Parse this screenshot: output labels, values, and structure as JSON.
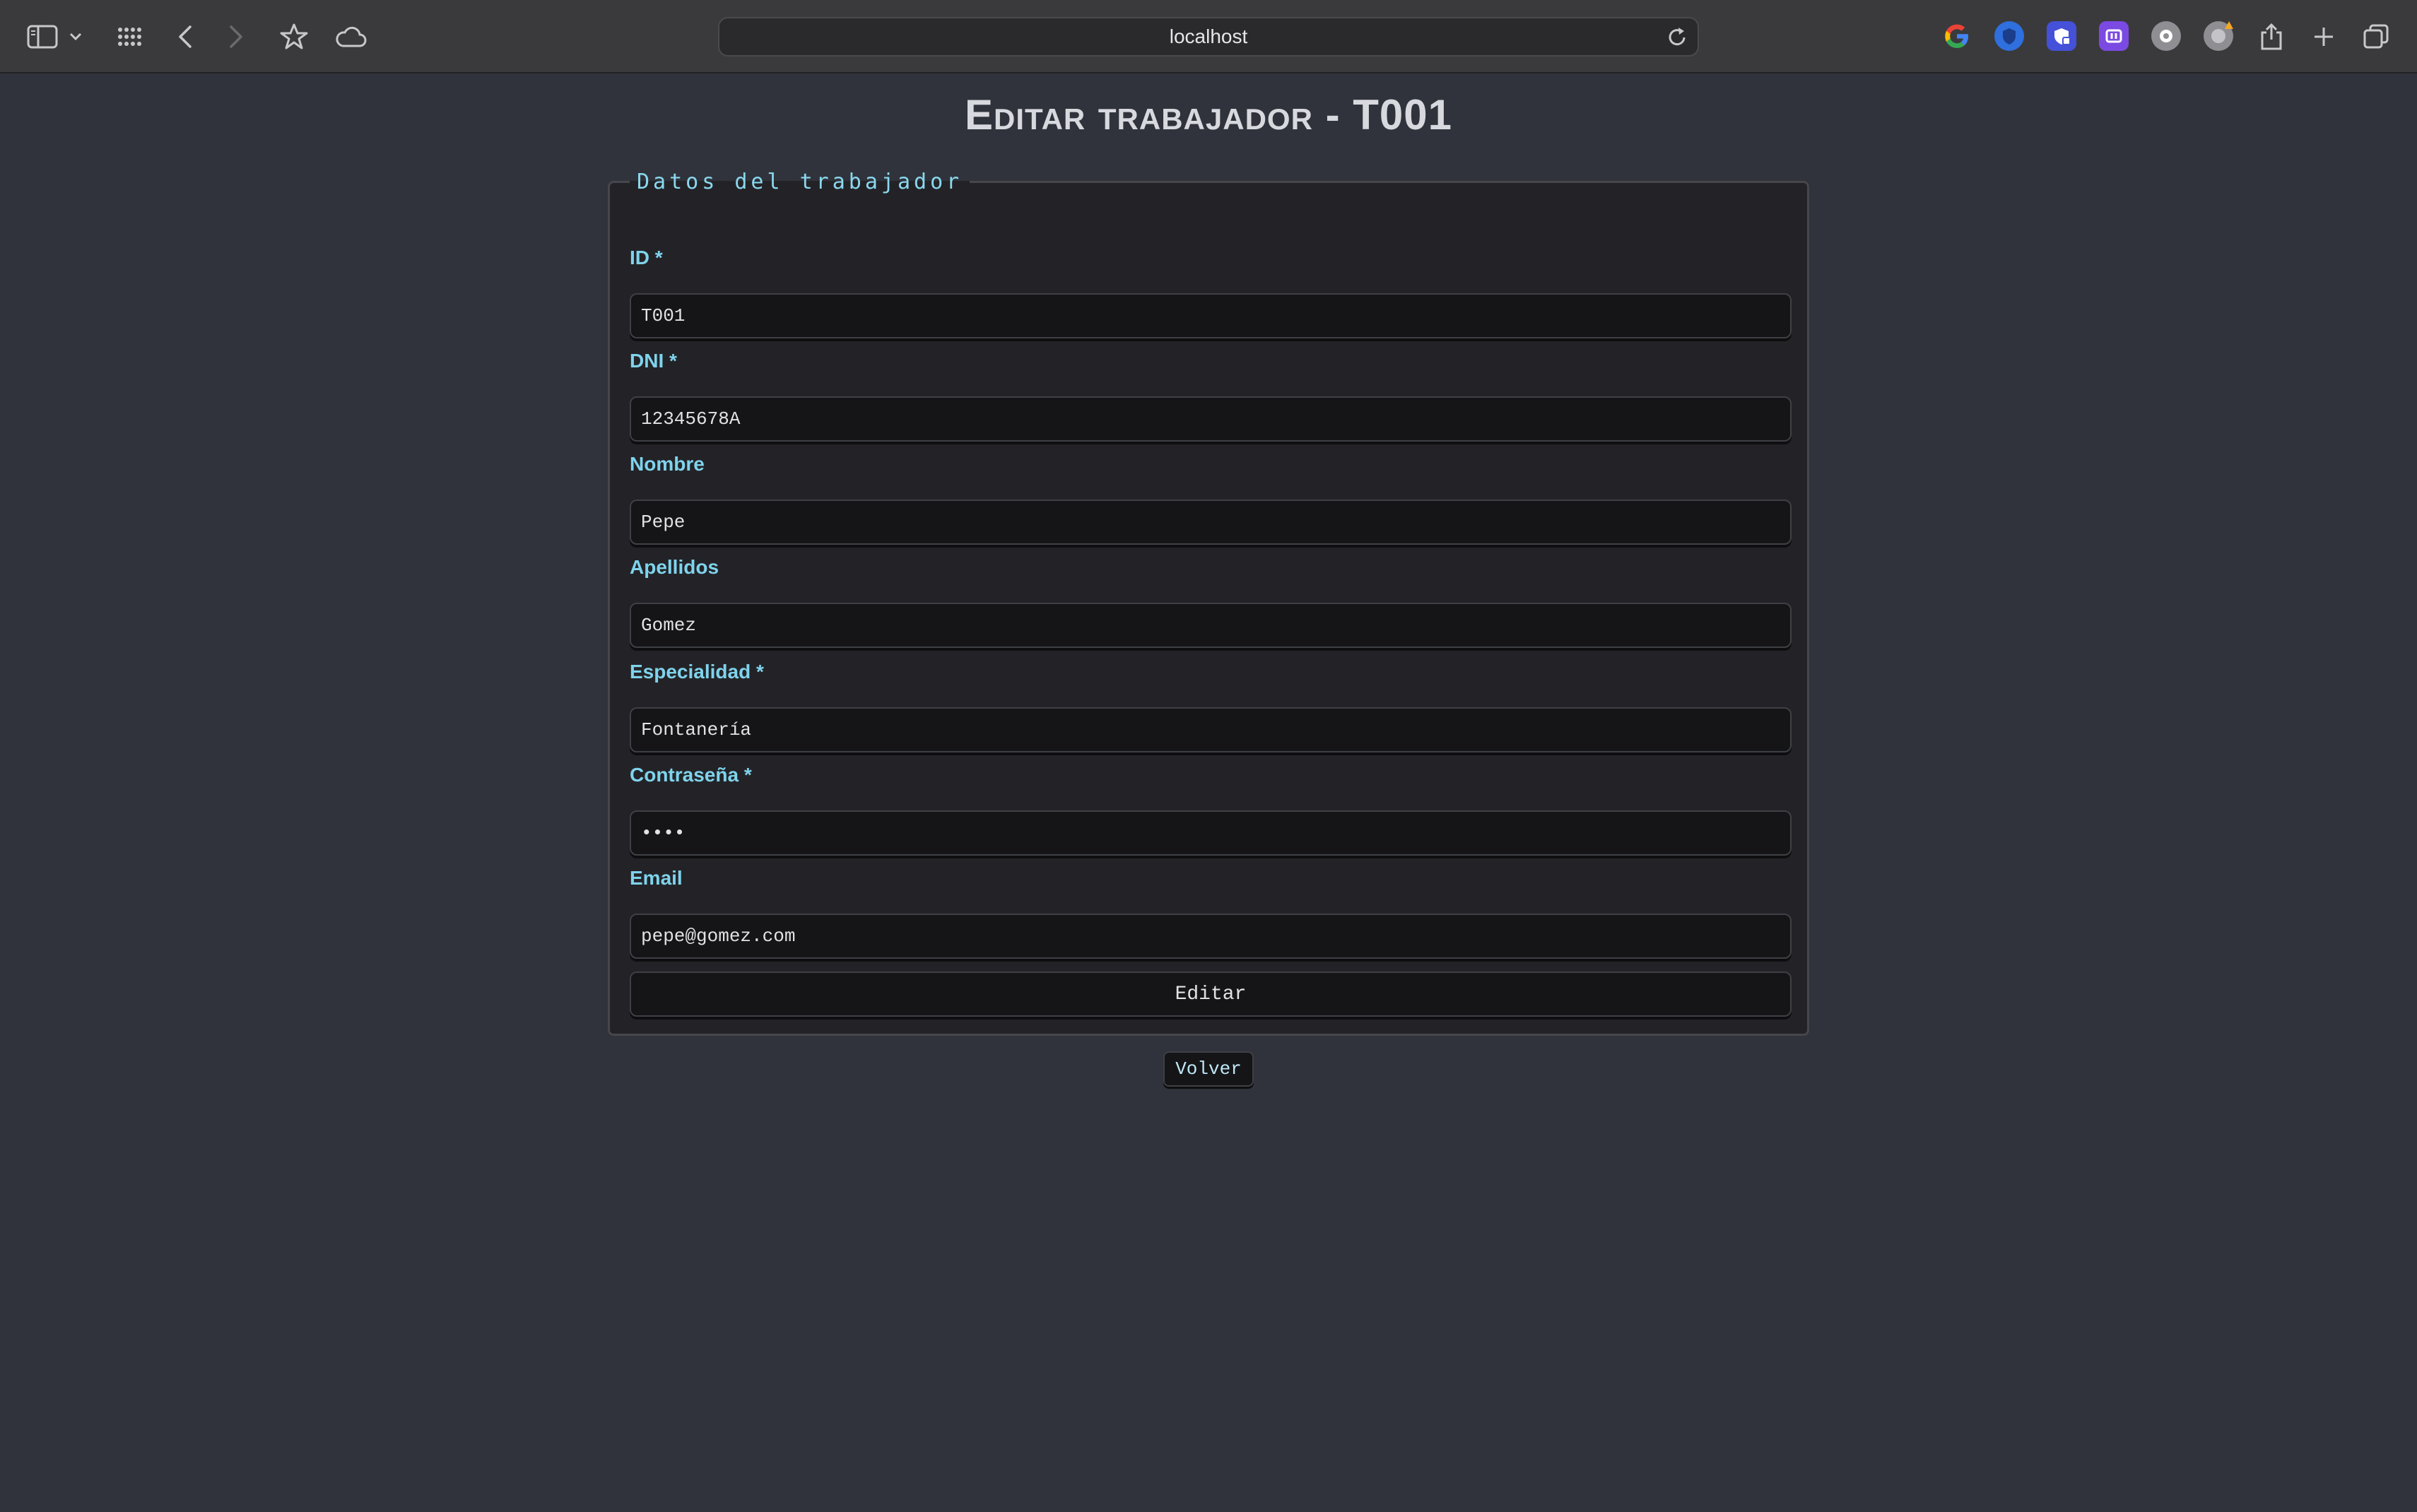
{
  "browser": {
    "url": "localhost",
    "extensions": [
      {
        "name": "google",
        "color": "#4285f4"
      },
      {
        "name": "blue-shield",
        "color": "#2f6fde"
      },
      {
        "name": "purple-shield",
        "color": "#4451d8"
      },
      {
        "name": "purple-app",
        "color": "#7b4ae2"
      },
      {
        "name": "gray-puzzle",
        "color": "#8e8e93"
      },
      {
        "name": "gray-badge",
        "color": "#8e8e93"
      }
    ]
  },
  "page": {
    "title": "Editar trabajador - T001"
  },
  "form": {
    "legend": "Datos del trabajador",
    "fields": [
      {
        "label": "ID *",
        "value": "T001",
        "type": "text"
      },
      {
        "label": "DNI *",
        "value": "12345678A",
        "type": "text"
      },
      {
        "label": "Nombre",
        "value": "Pepe",
        "type": "text"
      },
      {
        "label": "Apellidos",
        "value": "Gomez",
        "type": "text"
      },
      {
        "label": "Especialidad *",
        "value": "Fontanería",
        "type": "text"
      },
      {
        "label": "Contraseña *",
        "value": "1234",
        "type": "password"
      },
      {
        "label": "Email",
        "value": "pepe@gomez.com",
        "type": "email"
      }
    ],
    "submit_label": "Editar"
  },
  "back_label": "Volver",
  "colors": {
    "background": "#30333b",
    "card": "#232327",
    "label": "#7fd3ec",
    "input_bg": "#151518"
  }
}
